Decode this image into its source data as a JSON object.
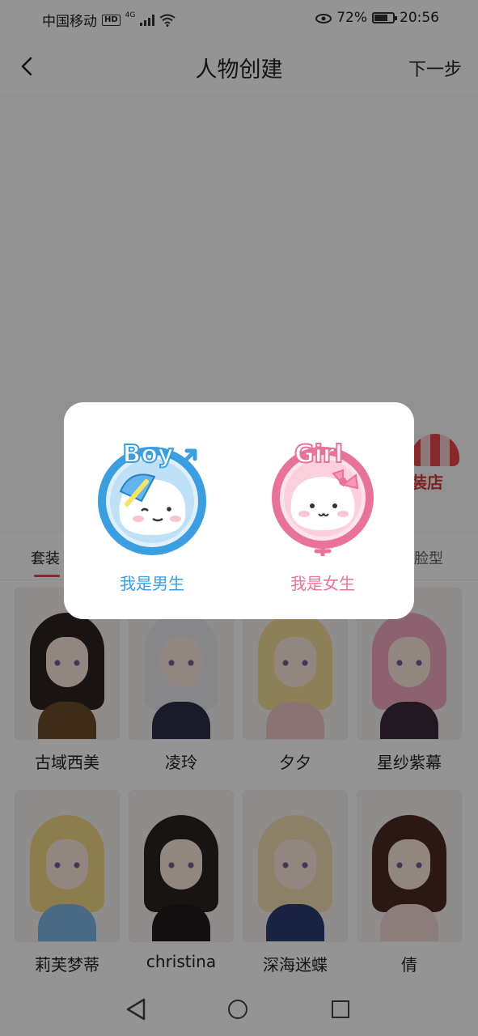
{
  "status_bar": {
    "carrier": "中国移动",
    "hd_badge": "HD",
    "network": "4G",
    "battery": "72%",
    "battery_level": 0.72,
    "time": "20:56"
  },
  "header": {
    "title": "人物创建",
    "next_label": "下一步"
  },
  "shop": {
    "label": "装店"
  },
  "tabs": {
    "items": [
      "套装",
      "脸型"
    ]
  },
  "characters": [
    {
      "name": "古域西美",
      "hair": "#2b2220",
      "body": "#6b4a2a"
    },
    {
      "name": "凌玲",
      "hair": "#e9e9ec",
      "body": "#2c2f4a"
    },
    {
      "name": "夕夕",
      "hair": "#f3dc9a",
      "body": "#f0c7c7"
    },
    {
      "name": "星纱紫幕",
      "hair": "#f1a9c2",
      "body": "#3a2a3f"
    },
    {
      "name": "莉芙梦蒂",
      "hair": "#f5d783",
      "body": "#7eb6e6"
    },
    {
      "name": "christina",
      "hair": "#2a2320",
      "body": "#1e1a1a"
    },
    {
      "name": "深海迷蝶",
      "hair": "#f2dfb0",
      "body": "#2b3f74"
    },
    {
      "name": "倩",
      "hair": "#4a2a24",
      "body": "#f3d6d6"
    }
  ],
  "modal": {
    "boy": {
      "icon_text": "Boy",
      "label": "我是男生",
      "color": "#3a9ee0"
    },
    "girl": {
      "icon_text": "Girl",
      "label": "我是女生",
      "color": "#e8739a"
    }
  }
}
